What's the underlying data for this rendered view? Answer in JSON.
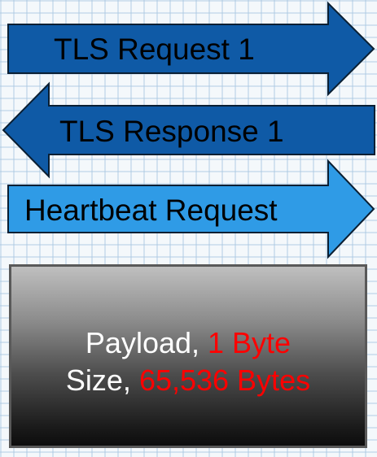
{
  "arrows": {
    "request": {
      "label": "TLS Request 1",
      "fill": "#0f5aa6",
      "direction": "right"
    },
    "response": {
      "label": "TLS Response 1",
      "fill": "#0f5aa6",
      "direction": "left"
    },
    "heartbeat": {
      "label": "Heartbeat Request",
      "fill": "#2f9be6",
      "direction": "right"
    }
  },
  "payload": {
    "line1_label": "Payload, ",
    "line1_value": "1 Byte",
    "line2_label": "Size, ",
    "line2_value": "65,536 Bytes"
  },
  "colors": {
    "highlight": "#ff0000",
    "text_light": "#ffffff",
    "arrow_stroke": "#0a1f33"
  }
}
